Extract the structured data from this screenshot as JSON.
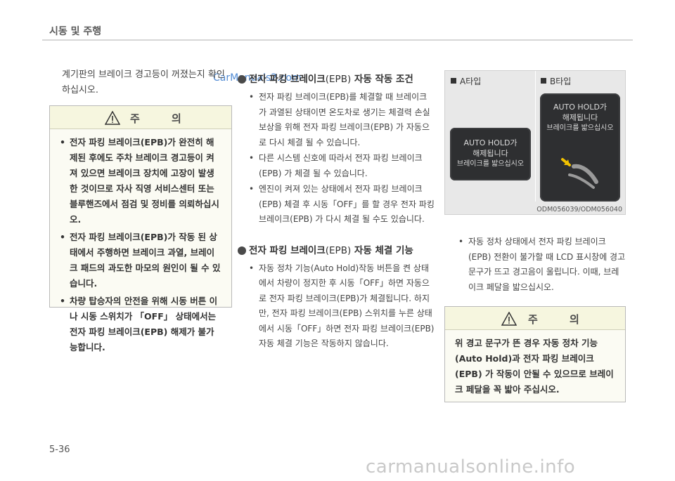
{
  "header": {
    "title": "시동 및 주행"
  },
  "watermark_top": "CarManuals2.com",
  "intro_text": "계기판의 브레이크 경고등이 꺼졌는지 확인하십시오.",
  "caution_left": {
    "title": "주 의",
    "items": [
      "전자 파킹 브레이크(EPB)가 완전히 해제된 후에도 주차 브레이크 경고등이 켜져 있으면 브레이크 장치에 고장이 발생한 것이므로 자사 직영 서비스센터 또는 블루핸즈에서 점검 및 정비를 의뢰하십시오.",
      "전자 파킹 브레이크(EPB)가 작동 된 상태에서 주행하면 브레이크 과열, 브레이크 패드의 과도한 마모의 원인이 될 수 있습니다.",
      "차량 탑승자의 안전을 위해 시동 버튼 이나 시동 스위치가 「OFF」 상태에서는 전자 파킹 브레이크(EPB) 해제가 불가능합니다."
    ]
  },
  "section_auto_apply": {
    "heading": "전자 파킹 브레이크",
    "heading_paren": "(EPB)",
    "heading_tail": " 자동 작동 조건",
    "items": [
      "전자 파킹 브레이크(EPB)를 체결할 때 브레이크가 과열된 상태이면 온도차로 생기는 체결력 손실 보상을 위해 전자 파킹 브레이크(EPB) 가 자동으로 다시 체결 될 수 있습니다.",
      "다른 시스템 신호에 따라서 전자 파킹 브레이크(EPB) 가 체결 될 수 있습니다.",
      "엔진이 켜져 있는 상태에서 전자 파킹 브레이크(EPB) 체결 후 시동「OFF」를 할 경우 전자 파킹 브레이크(EPB) 가 다시 체결 될 수도 있습니다."
    ]
  },
  "section_auto_engage": {
    "heading": "전자 파킹 브레이크",
    "heading_paren": "(EPB)",
    "heading_tail": " 자동 체결 기능",
    "items": [
      "자동 정차 기능(Auto Hold)작동 버튼을 켠 상태에서 차량이 정지한 후 시동「OFF」하면 자동으로 전자 파킹 브레이크(EPB)가 체결됩니다. 하지만, 전자 파킹 브레이크(EPB) 스위치를 누른 상태에서 시동「OFF」하면 전자 파킹 브레이크(EPB) 자동 체결 기능은 작동하지 않습니다."
    ]
  },
  "figure": {
    "label_a": "A타입",
    "label_b": "B타입",
    "screen_a_lines": [
      "AUTO HOLD가",
      "해제됩니다",
      "브레이크를 밟으십시오"
    ],
    "screen_b_lines": [
      "AUTO HOLD가",
      "해제됩니다",
      "브레이크를 밟으십시오"
    ],
    "caption": "ODM056039/ODM056040"
  },
  "right_items": [
    "자동 정차 상태에서 전자 파킹 브레이크(EPB) 전환이 불가할 때 LCD 표시창에 경고문구가 뜨고 경고음이 울립니다. 이때, 브레이크 페달을 밟으십시오."
  ],
  "caution_right": {
    "title": "주 의",
    "text": "위 경고 문구가 뜬 경우 자동 정차 기능(Auto Hold)과 전자 파킹 브레이크(EPB) 가 작동이 안될 수 있으므로 브레이크 페달을 꼭 밟아 주십시오."
  },
  "page_number": "5-36",
  "watermark_bottom": "carmanualsonline.info",
  "colors": {
    "caution_bg": "#fbfbf3",
    "caution_head_bg": "#f6f6df",
    "screen_bg": "#2e2f31",
    "figure_bg": "#e8e8e8",
    "accent_arrow": "#f2c200"
  }
}
